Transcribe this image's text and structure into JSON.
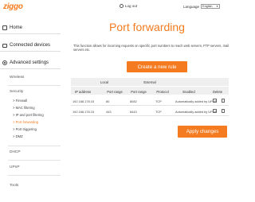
{
  "header": {
    "logo": "ziggo",
    "logout_label": "Log out",
    "language_label": "Language",
    "language_value": "English"
  },
  "sidebar": {
    "home": "Home",
    "connected_devices": "Connected devices",
    "advanced_settings": "Advanced settings",
    "wireless": "Wireless",
    "security": "Security",
    "security_items": [
      "> Firewall",
      "> MAC filtering",
      "> IP and port filtering",
      "> Port forwarding",
      "> Port triggering",
      "> DMZ"
    ],
    "dhcp": "DHCP",
    "upnp": "UPnP",
    "tools": "Tools"
  },
  "main": {
    "title": "Port forwarding",
    "description": "This function allows for incoming requests on specific port numbers to reach web servers, FTP servers, mail servers etc.",
    "create_button": "Create a new rule",
    "apply_button": "Apply changes",
    "table": {
      "group_local": "Local",
      "group_external": "External",
      "columns": [
        "IP address",
        "Port range",
        "Port range",
        "Protocol",
        "Enabled",
        "Delete"
      ],
      "rows": [
        {
          "ip": "192.168.178.15",
          "local_port": "80",
          "ext_port": "8082",
          "protocol": "TCP",
          "enabled": "Automatically added by UPNP"
        },
        {
          "ip": "192.168.178.15",
          "local_port": "443",
          "ext_port": "8443",
          "protocol": "TCP",
          "enabled": "Automatically added by UPNP"
        }
      ]
    }
  }
}
